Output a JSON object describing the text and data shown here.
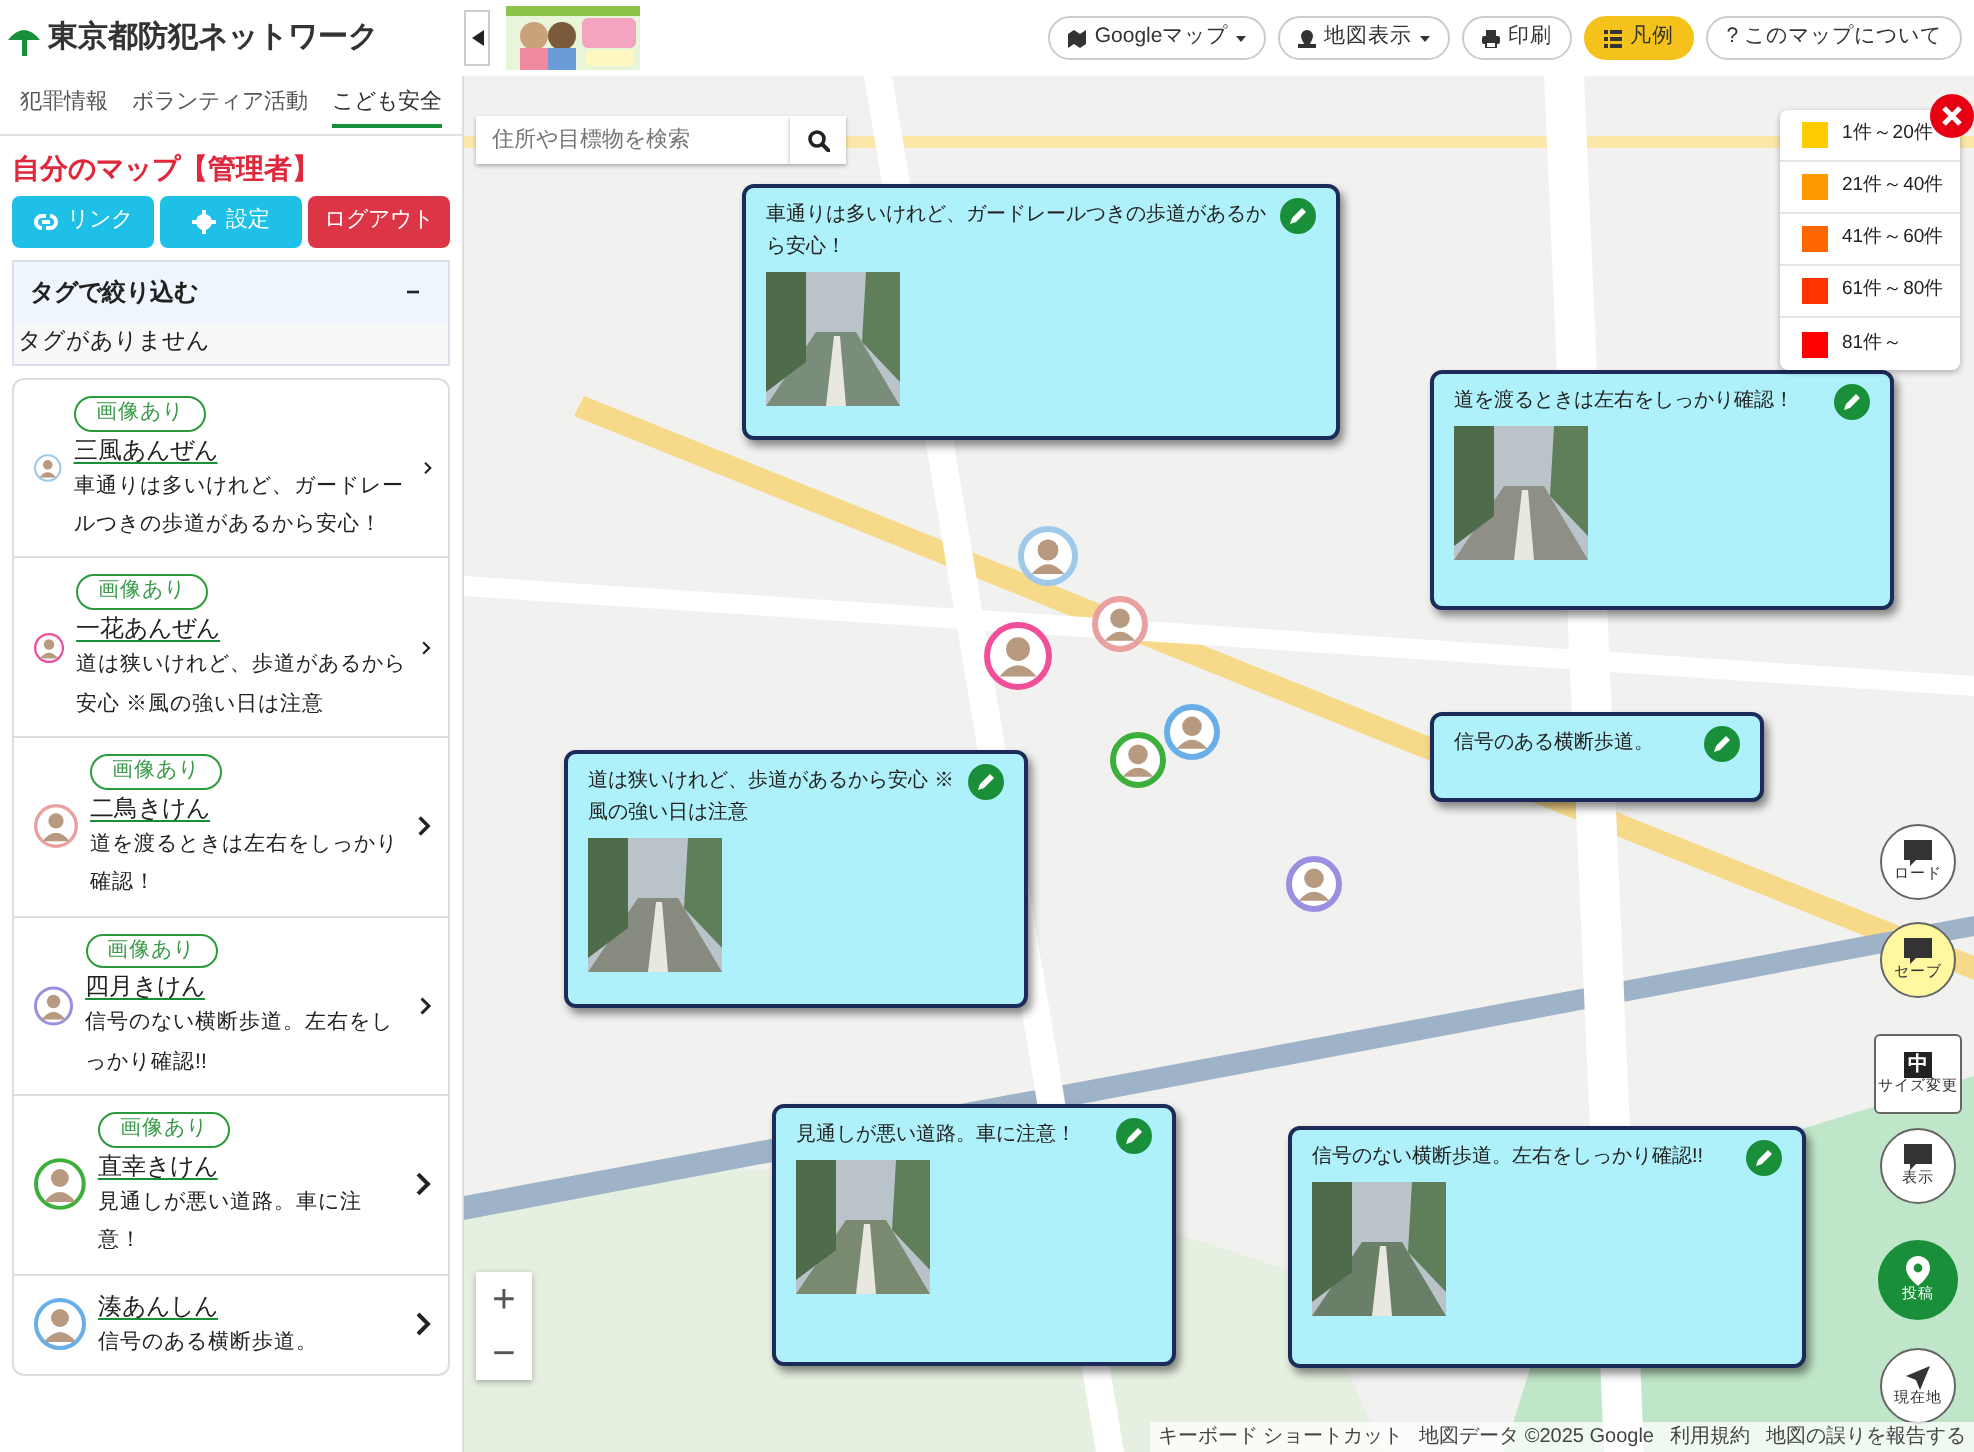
{
  "header": {
    "logo": "東京都防犯ネットワーク",
    "toolbar": [
      {
        "label": "Googleマップ",
        "kind": "map",
        "caret": true,
        "selected": false
      },
      {
        "label": "地図表示",
        "kind": "pin",
        "caret": true,
        "selected": false
      },
      {
        "label": "印刷",
        "kind": "print",
        "caret": false,
        "selected": false
      },
      {
        "label": "凡例",
        "kind": "list",
        "caret": false,
        "selected": true
      },
      {
        "label": "? このマップについて",
        "kind": "text",
        "caret": false,
        "selected": false
      }
    ]
  },
  "sidebar": {
    "tabs": [
      {
        "label": "犯罪情報",
        "selected": false
      },
      {
        "label": "ボランティア活動",
        "selected": false
      },
      {
        "label": "こども安全",
        "selected": true
      }
    ],
    "title": "自分のマップ【管理者】",
    "buttons": [
      {
        "label": "リンク",
        "kind": "link"
      },
      {
        "label": "設定",
        "kind": "settings"
      },
      {
        "label": "ログアウト",
        "kind": "logout"
      }
    ],
    "tag_filter": {
      "title": "タグで絞り込む",
      "toggle": "−",
      "empty_text": "タグがありません"
    },
    "posts": [
      {
        "badge": "画像あり",
        "name": "三風あんぜん",
        "text": "車通りは多いけれど、ガードレールつきの歩道があるから安心！",
        "color": "#9ec9e8"
      },
      {
        "badge": "画像あり",
        "name": "一花あんぜん",
        "text": "道は狭いけれど、歩道があるから安心 ※風の強い日は注意",
        "color": "#f0509a"
      },
      {
        "badge": "画像あり",
        "name": "二鳥きけん",
        "text": "道を渡るときは左右をしっかり確認！",
        "color": "#e8a0a0"
      },
      {
        "badge": "画像あり",
        "name": "四月きけん",
        "text": "信号のない横断歩道。左右をしっかり確認!!",
        "color": "#9b8fe0"
      },
      {
        "badge": "画像あり",
        "name": "直幸きけん",
        "text": "見通しが悪い道路。車に注意！",
        "color": "#3cae3c"
      },
      {
        "name": "湊あんしん",
        "text": "信号のある横断歩道。",
        "color": "#6aaee8"
      }
    ]
  },
  "map": {
    "search": {
      "placeholder": "住所や目標物を検索"
    },
    "legend": [
      {
        "label": "1件～20件",
        "color": "#ffcc00"
      },
      {
        "label": "21件～40件",
        "color": "#ff9900"
      },
      {
        "label": "41件～60件",
        "color": "#ff6600"
      },
      {
        "label": "61件～80件",
        "color": "#ff3300"
      },
      {
        "label": "81件～",
        "color": "#ff0000"
      }
    ],
    "markers": [
      {
        "color": "#9ec9e8"
      },
      {
        "color": "#f0509a"
      },
      {
        "color": "#e8a0a0"
      },
      {
        "color": "#3cae3c"
      },
      {
        "color": "#6aaee8"
      },
      {
        "color": "#9b8fe0"
      }
    ],
    "popups": [
      {
        "text": "車通りは多いけれど、ガードレールつきの歩道があるから安心！",
        "photo": true
      },
      {
        "text": "道を渡るときは左右をしっかり確認！",
        "photo": true
      },
      {
        "text": "信号のある横断歩道。",
        "photo": false
      },
      {
        "text": "道は狭いけれど、歩道があるから安心 ※風の強い日は注意",
        "photo": true
      },
      {
        "text": "見通しが悪い道路。車に注意！",
        "photo": true
      },
      {
        "text": "信号のない横断歩道。左右をしっかり確認!!",
        "photo": true
      }
    ],
    "controls": [
      {
        "label": "ロード",
        "kind": "load"
      },
      {
        "label": "セーブ",
        "kind": "save"
      },
      {
        "label": "サイズ変更",
        "kind": "size",
        "icon_text": "中"
      },
      {
        "label": "表示",
        "kind": "show"
      },
      {
        "label": "投稿",
        "kind": "post"
      },
      {
        "label": "現在地",
        "kind": "locate"
      }
    ],
    "zoom": [
      "+",
      "−"
    ],
    "attribution": [
      "キーボード ショートカット",
      "地図データ ©2025 Google",
      "利用規約",
      "地図の誤りを報告する"
    ]
  }
}
